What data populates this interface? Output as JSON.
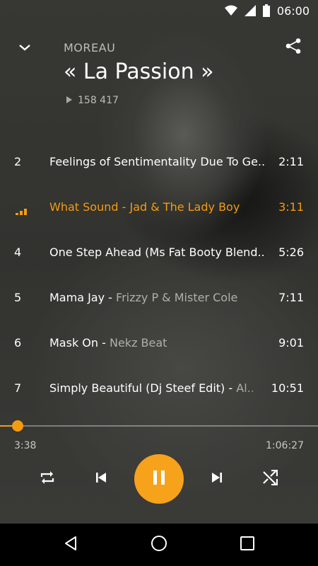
{
  "status_bar": {
    "time": "06:00"
  },
  "header": {
    "artist": "MOREAU",
    "album_title": "« La Passion »",
    "play_count": "158 417"
  },
  "tracks": [
    {
      "number": "2",
      "title": "Feelings of Sentimentality Due To Ge..",
      "artist": "",
      "duration": "2:11",
      "playing": false
    },
    {
      "number": "",
      "title": "What Sound",
      "artist": "Jad & The Lady Boy",
      "duration": "3:11",
      "playing": true
    },
    {
      "number": "4",
      "title": "One Step Ahead (Ms Fat Booty Blend..",
      "artist": "",
      "duration": "5:26",
      "playing": false
    },
    {
      "number": "5",
      "title": "Mama Jay",
      "artist": "Frizzy P & Mister Cole",
      "duration": "7:11",
      "playing": false
    },
    {
      "number": "6",
      "title": "Mask On",
      "artist": "Nekz Beat",
      "duration": "9:01",
      "playing": false
    },
    {
      "number": "7",
      "title": "Simply Beautiful (Dj Steef Edit)",
      "artist": "Al..",
      "duration": "10:51",
      "playing": false
    }
  ],
  "player": {
    "elapsed": "3:38",
    "total": "1:06:27",
    "progress_fraction": 0.055,
    "accent_color": "#f39c12"
  },
  "icons": {
    "collapse": "chevron-down-icon",
    "share": "share-icon",
    "repeat": "repeat-icon",
    "previous": "skip-previous-icon",
    "pause": "pause-icon",
    "next": "skip-next-icon",
    "shuffle": "shuffle-icon"
  }
}
